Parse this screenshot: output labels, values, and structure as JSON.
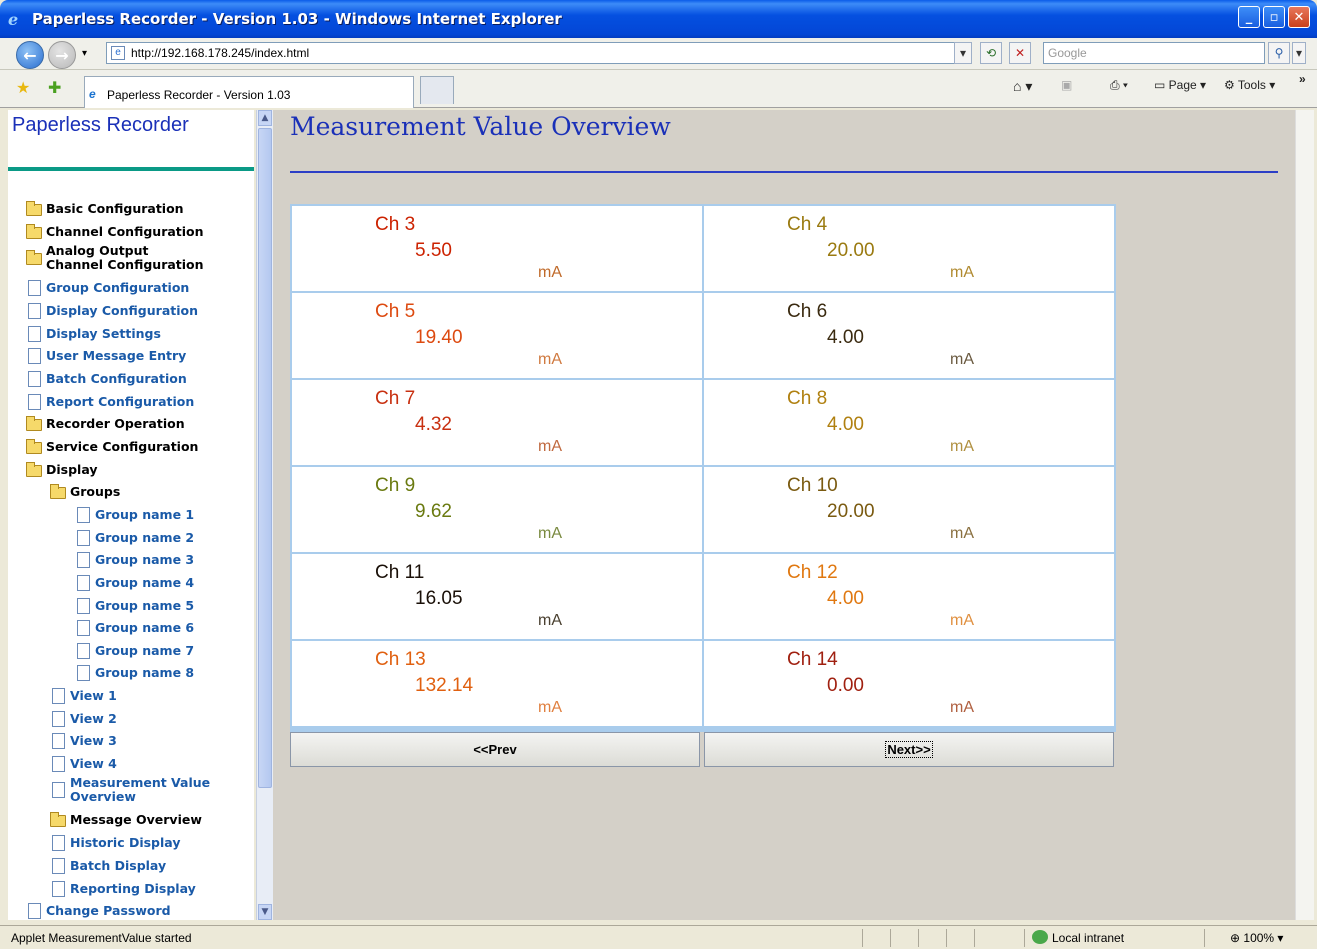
{
  "window": {
    "title": "Paperless Recorder - Version 1.03 - Windows Internet Explorer",
    "buttons": {
      "minimize": "_",
      "maximize": "▫",
      "close": "✕"
    }
  },
  "address_bar": {
    "url": "http://192.168.178.245/index.html",
    "search_placeholder": "Google"
  },
  "tab": {
    "label": "Paperless Recorder - Version 1.03"
  },
  "toolbar": {
    "page_label": "Page",
    "tools_label": "Tools"
  },
  "sidebar": {
    "title": "Paperless Recorder",
    "items": [
      {
        "label": "Basic Configuration",
        "type": "folder",
        "level": 0
      },
      {
        "label": "Channel Configuration",
        "type": "folder",
        "level": 0
      },
      {
        "label": "Analog Output Channel Configuration",
        "type": "folder",
        "level": 0
      },
      {
        "label": "Group Configuration",
        "type": "page",
        "level": 0
      },
      {
        "label": "Display Configuration",
        "type": "page",
        "level": 0
      },
      {
        "label": "Display Settings",
        "type": "page",
        "level": 0
      },
      {
        "label": "User Message Entry",
        "type": "page",
        "level": 0
      },
      {
        "label": "Batch Configuration",
        "type": "page",
        "level": 0
      },
      {
        "label": "Report Configuration",
        "type": "page",
        "level": 0
      },
      {
        "label": "Recorder Operation",
        "type": "folder",
        "level": 0
      },
      {
        "label": "Service Configuration",
        "type": "folder",
        "level": 0
      },
      {
        "label": "Display",
        "type": "folder-open",
        "level": 0
      },
      {
        "label": "Groups",
        "type": "folder-open",
        "level": 1
      },
      {
        "label": "Group name 1",
        "type": "page",
        "level": 2
      },
      {
        "label": "Group name 2",
        "type": "page",
        "level": 2
      },
      {
        "label": "Group name 3",
        "type": "page",
        "level": 2
      },
      {
        "label": "Group name 4",
        "type": "page",
        "level": 2
      },
      {
        "label": "Group name 5",
        "type": "page",
        "level": 2
      },
      {
        "label": "Group name 6",
        "type": "page",
        "level": 2
      },
      {
        "label": "Group name 7",
        "type": "page",
        "level": 2
      },
      {
        "label": "Group name 8",
        "type": "page",
        "level": 2
      },
      {
        "label": "View 1",
        "type": "page",
        "level": 1
      },
      {
        "label": "View 2",
        "type": "page",
        "level": 1
      },
      {
        "label": "View 3",
        "type": "page",
        "level": 1
      },
      {
        "label": "View 4",
        "type": "page",
        "level": 1
      },
      {
        "label": "Measurement Value Overview",
        "type": "page",
        "level": 1
      },
      {
        "label": "Message Overview",
        "type": "folder",
        "level": 1
      },
      {
        "label": "Historic Display",
        "type": "page",
        "level": 1
      },
      {
        "label": "Batch Display",
        "type": "page",
        "level": 1
      },
      {
        "label": "Reporting Display",
        "type": "page",
        "level": 1
      },
      {
        "label": "Change Password",
        "type": "page",
        "level": 0
      }
    ]
  },
  "main": {
    "title": "Measurement Value Overview",
    "channels": [
      {
        "channel": "Ch 3",
        "value": "5.50",
        "unit": "mA",
        "color": "#cc2200",
        "unit_color": "#c06a2a"
      },
      {
        "channel": "Ch 4",
        "value": "20.00",
        "unit": "mA",
        "color": "#9a7a10",
        "unit_color": "#b08a30"
      },
      {
        "channel": "Ch 5",
        "value": "19.40",
        "unit": "mA",
        "color": "#dd4a10",
        "unit_color": "#d07a40"
      },
      {
        "channel": "Ch 6",
        "value": "4.00",
        "unit": "mA",
        "color": "#3a2a10",
        "unit_color": "#6a5a40"
      },
      {
        "channel": "Ch 7",
        "value": "4.32",
        "unit": "mA",
        "color": "#c83010",
        "unit_color": "#c06a40"
      },
      {
        "channel": "Ch 8",
        "value": "4.00",
        "unit": "mA",
        "color": "#b08010",
        "unit_color": "#b09040"
      },
      {
        "channel": "Ch 9",
        "value": "9.62",
        "unit": "mA",
        "color": "#6a7a10",
        "unit_color": "#7a8a40"
      },
      {
        "channel": "Ch 10",
        "value": "20.00",
        "unit": "mA",
        "color": "#7a5a10",
        "unit_color": "#8a7040"
      },
      {
        "channel": "Ch 11",
        "value": "16.05",
        "unit": "mA",
        "color": "#1a1008",
        "unit_color": "#4a4030"
      },
      {
        "channel": "Ch 12",
        "value": "4.00",
        "unit": "mA",
        "color": "#e07810",
        "unit_color": "#e09040"
      },
      {
        "channel": "Ch 13",
        "value": "132.14",
        "unit": "mA",
        "color": "#e06010",
        "unit_color": "#e08040"
      },
      {
        "channel": "Ch 14",
        "value": "0.00",
        "unit": "mA",
        "color": "#a02010",
        "unit_color": "#b06040"
      }
    ],
    "prev_label": "<<Prev",
    "next_label": "Next>>"
  },
  "status_bar": {
    "message": "Applet MeasurementValue started",
    "zone": "Local intranet",
    "zoom": "100%"
  }
}
